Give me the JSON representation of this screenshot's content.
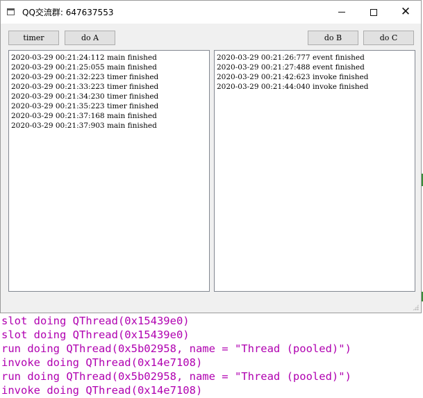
{
  "window": {
    "title": "QQ交流群: 647637553",
    "controls": {
      "minimize": "minimize",
      "maximize": "maximize",
      "close": "✕"
    }
  },
  "toolbar": {
    "timer_label": "timer",
    "do_a_label": "do A",
    "do_b_label": "do B",
    "do_c_label": "do C"
  },
  "left_log": [
    "2020-03-29 00:21:24:112 main finished",
    "2020-03-29 00:21:25:055 main finished",
    "2020-03-29 00:21:32:223 timer finished",
    "2020-03-29 00:21:33:223 timer finished",
    "2020-03-29 00:21:34:230 timer finished",
    "2020-03-29 00:21:35:223 timer finished",
    "2020-03-29 00:21:37:168 main finished",
    "2020-03-29 00:21:37:903 main finished"
  ],
  "right_log": [
    "2020-03-29 00:21:26:777 event finished",
    "2020-03-29 00:21:27:488 event finished",
    "2020-03-29 00:21:42:623 invoke finished",
    "2020-03-29 00:21:44:040 invoke finished"
  ],
  "console": [
    "slot doing QThread(0x15439e0)",
    "slot doing QThread(0x15439e0)",
    "run doing QThread(0x5b02958, name = \"Thread (pooled)\")",
    "invoke doing QThread(0x14e7108)",
    "run doing QThread(0x5b02958, name = \"Thread (pooled)\")",
    "invoke doing QThread(0x14e7108)"
  ],
  "colors": {
    "console_text": "#b000b0",
    "window_bg": "#f0f0f0",
    "log_bg": "#ffffff"
  }
}
